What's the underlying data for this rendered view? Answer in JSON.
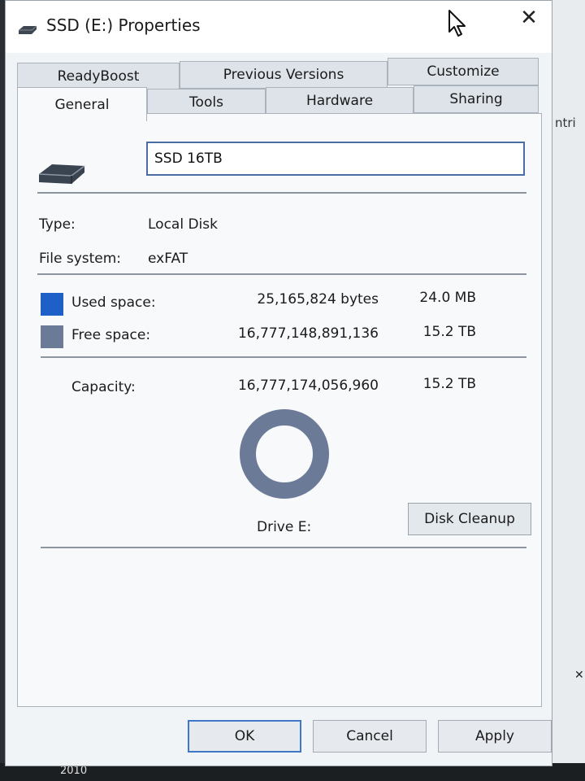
{
  "window": {
    "title": "SSD (E:) Properties",
    "close_label": "✕"
  },
  "tabs_top": [
    {
      "label": "ReadyBoost"
    },
    {
      "label": "Previous Versions"
    },
    {
      "label": "Customize"
    }
  ],
  "tabs_bottom": [
    {
      "label": "General",
      "active": true
    },
    {
      "label": "Tools"
    },
    {
      "label": "Hardware"
    },
    {
      "label": "Sharing"
    }
  ],
  "general": {
    "volume_name": "SSD 16TB",
    "type_label": "Type:",
    "type_value": "Local Disk",
    "fs_label": "File system:",
    "fs_value": "exFAT",
    "used_label": "Used space:",
    "used_bytes": "25,165,824 bytes",
    "used_size": "24.0 MB",
    "free_label": "Free space:",
    "free_bytes": "16,777,148,891,136",
    "free_size": "15.2 TB",
    "capacity_label": "Capacity:",
    "capacity_bytes": "16,777,174,056,960",
    "capacity_size": "15.2 TB",
    "drive_label": "Drive E:",
    "cleanup_label": "Disk Cleanup",
    "used_fraction": 1.5e-06
  },
  "colors": {
    "used": "#1f5fc8",
    "free": "#6b7a96",
    "accent": "#3f78c8"
  },
  "buttons": {
    "ok": "OK",
    "cancel": "Cancel",
    "apply": "Apply"
  },
  "background": {
    "side_text": "ntri",
    "side_close": "✕",
    "taskbar_year": "2010"
  }
}
